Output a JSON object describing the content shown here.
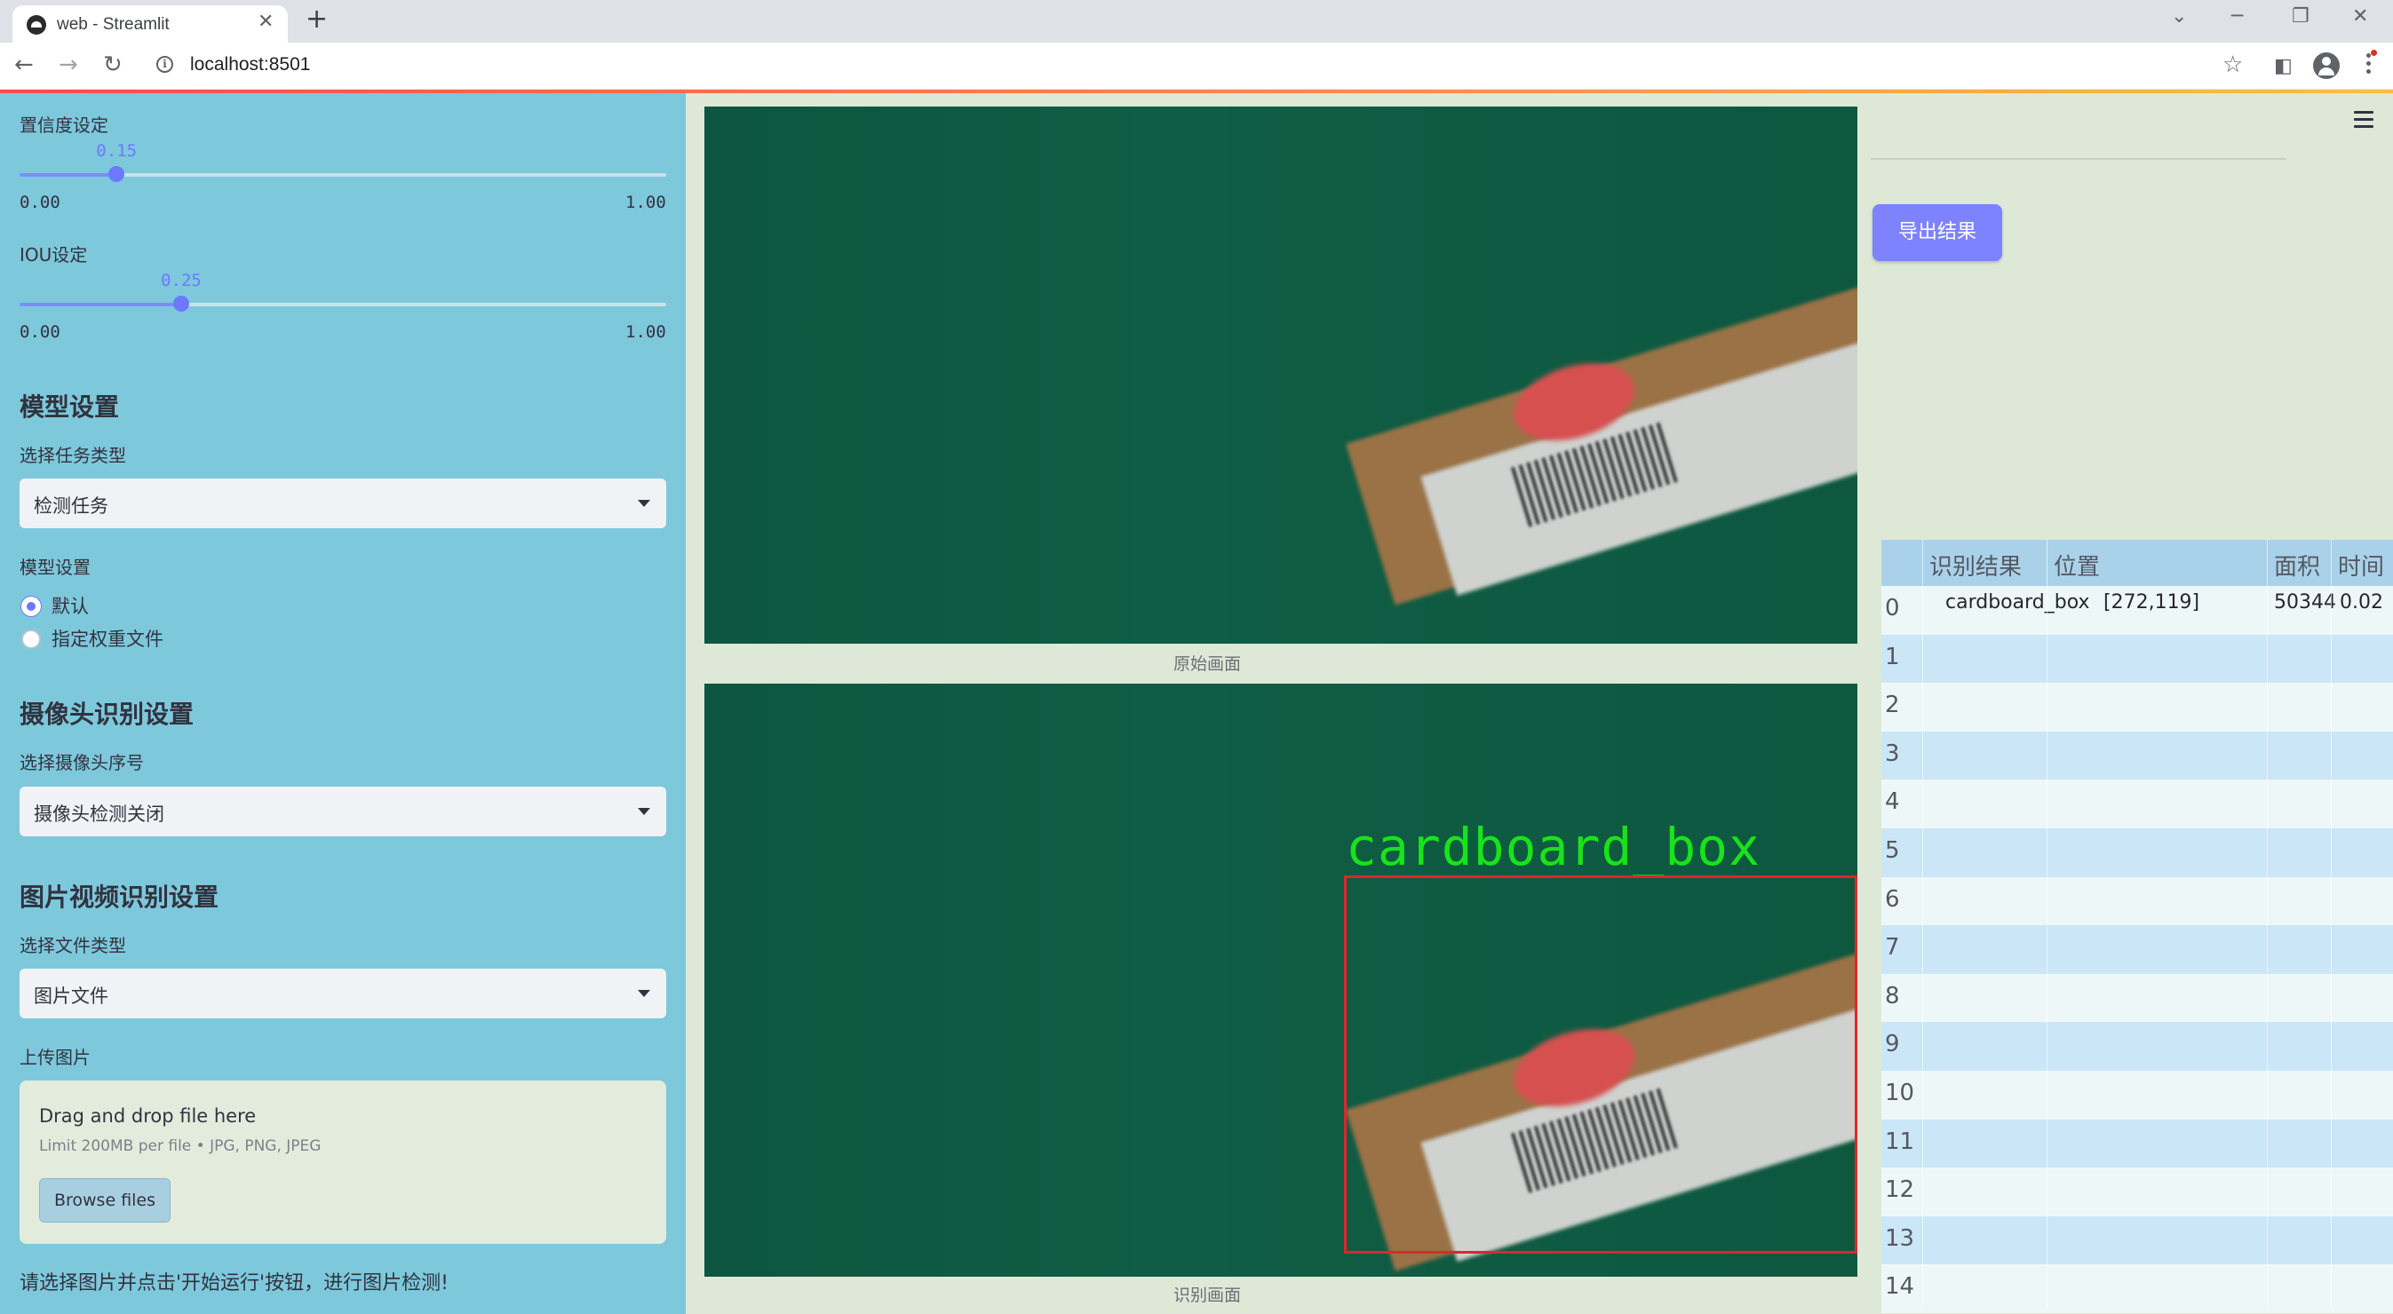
{
  "browser": {
    "tab_title": "web - Streamlit",
    "url": "localhost:8501"
  },
  "sidebar": {
    "confidence": {
      "label": "置信度设定",
      "value": "0.15",
      "min": "0.00",
      "max": "1.00",
      "fraction": 0.15
    },
    "iou": {
      "label": "IOU设定",
      "value": "0.25",
      "min": "0.00",
      "max": "1.00",
      "fraction": 0.25
    },
    "model_section": "模型设置",
    "task_type_label": "选择任务类型",
    "task_type_value": "检测任务",
    "model_settings_label": "模型设置",
    "radio_default": "默认",
    "radio_custom": "指定权重文件",
    "camera_section": "摄像头识别设置",
    "camera_label": "选择摄像头序号",
    "camera_value": "摄像头检测关闭",
    "media_section": "图片视频识别设置",
    "file_type_label": "选择文件类型",
    "file_type_value": "图片文件",
    "upload_label": "上传图片",
    "upload_title": "Drag and drop file here",
    "upload_limit": "Limit 200MB per file • JPG, PNG, JPEG",
    "browse_label": "Browse files",
    "hint": "请选择图片并点击'开始运行'按钮，进行图片检测!"
  },
  "main": {
    "original_caption": "原始画面",
    "result_caption": "识别画面",
    "detection_label": "cardboard_box",
    "export_label": "导出结果"
  },
  "table": {
    "headers": [
      "识别结果",
      "位置",
      "面积",
      "时间"
    ],
    "rows": [
      {
        "index": "0",
        "result": "cardboard_box",
        "position": "[272,119]",
        "area": "50344",
        "time": "0.02"
      },
      {
        "index": "1"
      },
      {
        "index": "2"
      },
      {
        "index": "3"
      },
      {
        "index": "4"
      },
      {
        "index": "5"
      },
      {
        "index": "6"
      },
      {
        "index": "7"
      },
      {
        "index": "8"
      },
      {
        "index": "9"
      },
      {
        "index": "10"
      },
      {
        "index": "11"
      },
      {
        "index": "12"
      },
      {
        "index": "13"
      },
      {
        "index": "14"
      }
    ]
  },
  "colors": {
    "sidebar": "#7ec8dc",
    "accent": "#6c79ff",
    "detection_box": "#e0262a",
    "detection_text": "#19e31b"
  }
}
